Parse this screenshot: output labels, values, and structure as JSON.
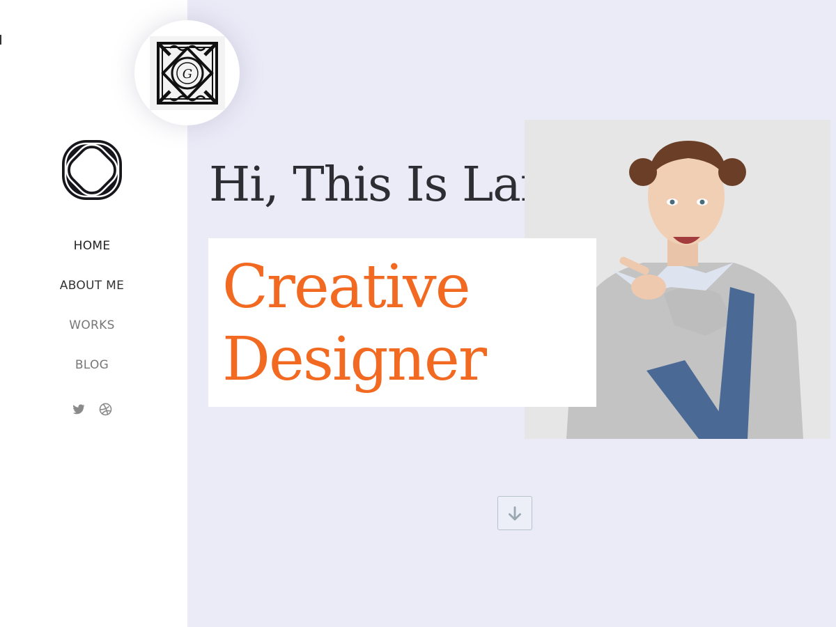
{
  "nav": {
    "items": [
      {
        "label": "HOME"
      },
      {
        "label": "ABOUT ME"
      },
      {
        "label": "WORKS"
      },
      {
        "label": "BLOG"
      }
    ]
  },
  "social": {
    "icons": [
      "twitter-icon",
      "dribbble-icon"
    ]
  },
  "badge": {
    "letter": "G",
    "icon": "ornamental-g-logo"
  },
  "hero": {
    "title": "Hi, This Is Lara",
    "tagline_line1": "Creative",
    "tagline_line2": "Designer"
  },
  "scroll": {
    "icon": "arrow-down-icon"
  },
  "colors": {
    "background": "#ebeaf7",
    "accent": "#f26a21",
    "text_dark": "#2d2d33",
    "sidebar": "#ffffff"
  }
}
